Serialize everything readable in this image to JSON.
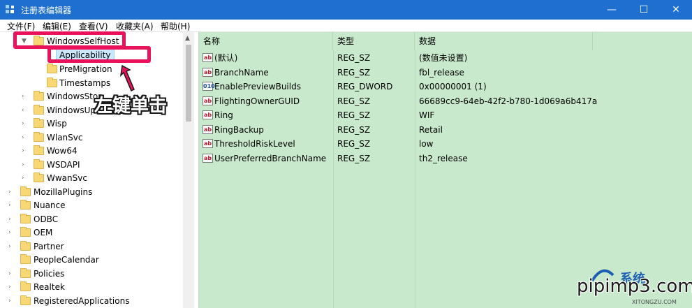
{
  "window": {
    "title": "注册表编辑器",
    "minimize": "—",
    "maximize": "☐",
    "close": "✕"
  },
  "menu": [
    "文件(F)",
    "编辑(E)",
    "查看(V)",
    "收藏夹(A)",
    "帮助(H)"
  ],
  "tree": [
    {
      "label": "WindowsSelfHost",
      "level": 2,
      "expanded": true
    },
    {
      "label": "Applicability",
      "level": 3,
      "selected": true
    },
    {
      "label": "PreMigration",
      "level": 3
    },
    {
      "label": "Timestamps",
      "level": 3
    },
    {
      "label": "WindowsStor",
      "level": 2
    },
    {
      "label": "WindowsUp",
      "level": 2
    },
    {
      "label": "Wisp",
      "level": 2
    },
    {
      "label": "WlanSvc",
      "level": 2
    },
    {
      "label": "Wow64",
      "level": 2
    },
    {
      "label": "WSDAPI",
      "level": 2
    },
    {
      "label": "WwanSvc",
      "level": 2
    },
    {
      "label": "MozillaPlugins",
      "level": 1
    },
    {
      "label": "Nuance",
      "level": 1
    },
    {
      "label": "ODBC",
      "level": 1
    },
    {
      "label": "OEM",
      "level": 1
    },
    {
      "label": "Partner",
      "level": 1
    },
    {
      "label": "PeopleCalendar",
      "level": 1
    },
    {
      "label": "Policies",
      "level": 1
    },
    {
      "label": "Realtek",
      "level": 1
    },
    {
      "label": "RegisteredApplications",
      "level": 1
    }
  ],
  "columns": {
    "name": "名称",
    "type": "类型",
    "data": "数据"
  },
  "values": [
    {
      "icon": "ab",
      "name": "(默认)",
      "type": "REG_SZ",
      "data": "(数值未设置)"
    },
    {
      "icon": "ab",
      "name": "BranchName",
      "type": "REG_SZ",
      "data": "fbl_release"
    },
    {
      "icon": "010",
      "name": "EnablePreviewBuilds",
      "type": "REG_DWORD",
      "data": "0x00000001 (1)"
    },
    {
      "icon": "ab",
      "name": "FlightingOwnerGUID",
      "type": "REG_SZ",
      "data": "66689cc9-64eb-42f2-b780-1d069a6b417a"
    },
    {
      "icon": "ab",
      "name": "Ring",
      "type": "REG_SZ",
      "data": "WIF"
    },
    {
      "icon": "ab",
      "name": "RingBackup",
      "type": "REG_SZ",
      "data": "Retail"
    },
    {
      "icon": "ab",
      "name": "ThresholdRiskLevel",
      "type": "REG_SZ",
      "data": "low"
    },
    {
      "icon": "ab",
      "name": "UserPreferredBranchName",
      "type": "REG_SZ",
      "data": "th2_release"
    }
  ],
  "annotation": {
    "text": "左键单击",
    "color": "#e8135a"
  },
  "watermark": {
    "text": "pipimp3.com",
    "top": "系统",
    "sub": "XITONGZU.COM"
  },
  "colors": {
    "titlebar": "#1e6fd0",
    "values_bg": "#c9e9cd",
    "selection": "#cce8ff"
  }
}
